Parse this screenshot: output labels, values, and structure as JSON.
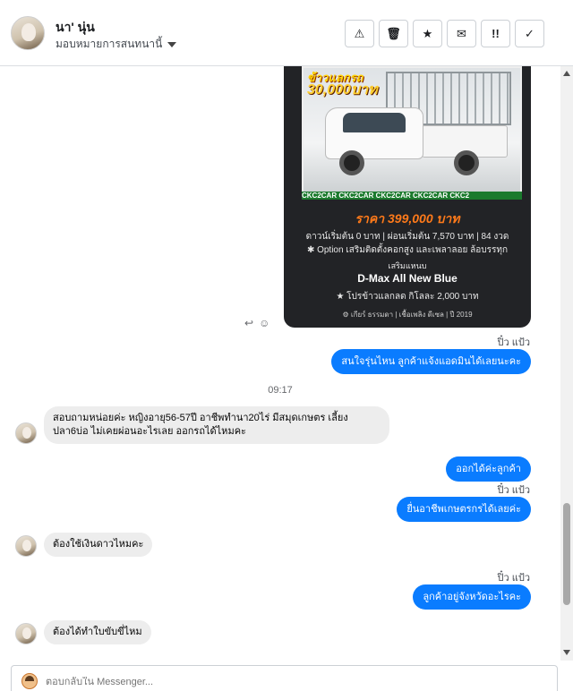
{
  "header": {
    "contact_name": "นา' นุ่น",
    "assign_label": "มอบหมายการสนทนานี้",
    "tools": [
      {
        "icon": "alert-icon",
        "glyph": "⚠"
      },
      {
        "icon": "trash-icon",
        "glyph": "🗑"
      },
      {
        "icon": "star-icon",
        "glyph": "★"
      },
      {
        "icon": "mark-unread-icon",
        "glyph": "✉"
      },
      {
        "icon": "follow-up-icon",
        "glyph": "!!"
      },
      {
        "icon": "check-icon",
        "glyph": "✓"
      }
    ]
  },
  "ad": {
    "promo_line1": "ข้าวแลกรถ",
    "promo_line2": "30,000บาท",
    "brand_band": "CKC2CAR CKC2CAR CKC2CAR CKC2CAR CKC2",
    "price": "ราคา 399,000 บาท",
    "terms": "ดาวน์เริ่มต้น 0 บาท | ผ่อนเริ่มต้น 7,570 บาท | 84 งวด",
    "option": "✱ Option เสริมติดตั้งคอกสูง และเพลาลอย ล้อบรรทุก",
    "extra": "เสริมแหนบ",
    "model": "D-Max All New Blue",
    "rice_promo": "★ โปรข้าวแลกลด กิโลละ 2,000 บาท",
    "footer": "⚙ เกียร์ ธรรมดา  |  เชื้อเพลิง ดีเซล  |  ปี 2019"
  },
  "messages": {
    "sender_name": "ปิ๋ว แป้ว",
    "out_1": "สนใจรุ่นไหน ลูกค้าแจ้งแอดมินได้เลยนะคะ",
    "timestamp": "09:17",
    "in_1": "สอบถามหน่อยค่ะ  หญิงอายุ56-57ปี   อาชีพทำนา20ไร่ มีสมุดเกษตร  เลี้ยงปลา6บ่อ   ไม่เคยผ่อนอะไรเลย   ออกรถได้ไหมคะ",
    "out_2": "ออกได้ค่ะลูกค้า",
    "out_3": "ยื่นอาชีพเกษตรกรได้เลยค่ะ",
    "in_2": "ต้องใช้เงินดาวไหมคะ",
    "out_4": "ลูกค้าอยู่จังหวัดอะไรคะ",
    "in_3": "ต้องได้ทำใบขับขี่ไหม"
  },
  "composer": {
    "placeholder": "ตอบกลับใน Messenger..."
  }
}
